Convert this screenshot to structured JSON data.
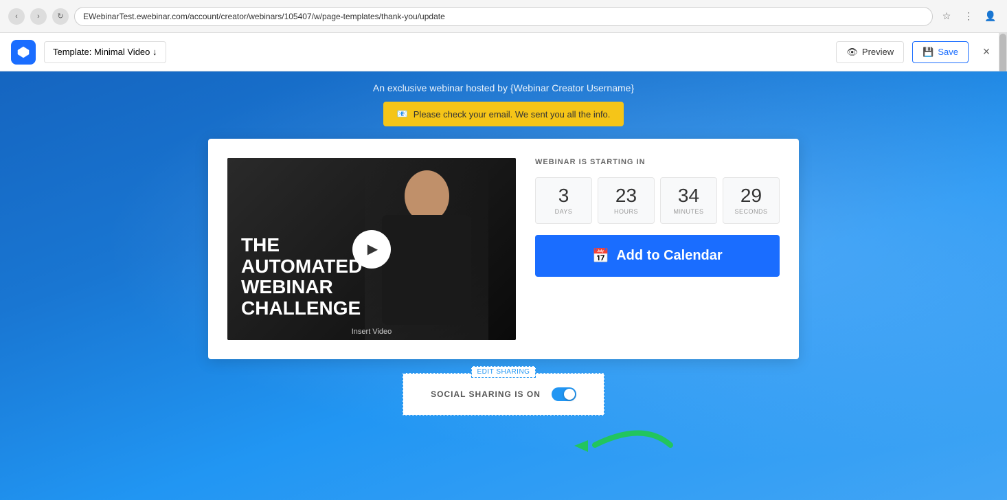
{
  "browser": {
    "url": "EWebinarTest.ewebinar.com/account/creator/webinars/105407/w/page-templates/thank-you/update"
  },
  "header": {
    "logo_icon": "cube-icon",
    "template_label": "Template: Minimal Video ↓",
    "preview_label": "Preview",
    "save_label": "Save",
    "close_label": "×"
  },
  "page": {
    "hosted_text": "An exclusive webinar hosted by {Webinar Creator Username}",
    "email_banner": "Please check your email. We sent you all the info.",
    "webinar_starting_label": "WEBINAR IS STARTING IN",
    "countdown": {
      "days": {
        "value": "3",
        "label": "DAYS"
      },
      "hours": {
        "value": "23",
        "label": "HOURS"
      },
      "minutes": {
        "value": "34",
        "label": "MINUTES"
      },
      "seconds": {
        "value": "29",
        "label": "SECONDS"
      }
    },
    "add_calendar_btn": "Add to Calendar",
    "video_title_line1": "THE",
    "video_title_line2": "AUTOMATED",
    "video_title_line3": "WEBINAR",
    "video_title_line4": "CHALLENGE",
    "insert_video_label": "Insert Video",
    "edit_sharing_label": "EDIT SHARING",
    "social_sharing_text": "SOCIAL SHARING IS ON"
  }
}
